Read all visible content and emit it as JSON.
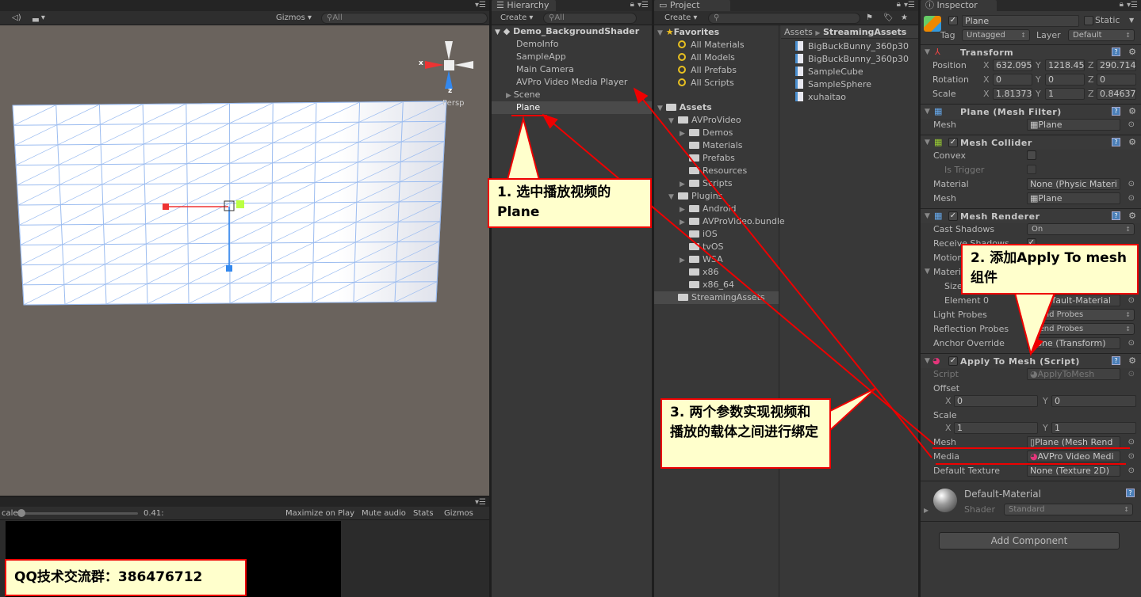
{
  "scene": {
    "gizmos_label": "Gizmos",
    "search_placeholder": "All",
    "gizmo_x": "x",
    "gizmo_z": "z",
    "persp_label": "Persp"
  },
  "game": {
    "scale_label": "cale",
    "scale_value": "0.41:",
    "buttons": [
      "Maximize on Play",
      "Mute audio",
      "Stats",
      "Gizmos"
    ]
  },
  "hierarchy": {
    "tab": "Hierarchy",
    "create": "Create",
    "search_placeholder": "All",
    "scene_name": "Demo_BackgroundShader",
    "items": [
      "DemoInfo",
      "SampleApp",
      "Main Camera",
      "AVPro Video Media Player",
      "Scene",
      "Plane"
    ],
    "selected": "Plane"
  },
  "project": {
    "tab": "Project",
    "create": "Create",
    "favorites_label": "Favorites",
    "favorites": [
      "All Materials",
      "All Models",
      "All Prefabs",
      "All Scripts"
    ],
    "assets_label": "Assets",
    "tree": [
      {
        "name": "AVProVideo",
        "level": 1,
        "arrow": "down"
      },
      {
        "name": "Demos",
        "level": 2,
        "arrow": "right"
      },
      {
        "name": "Materials",
        "level": 2,
        "arrow": ""
      },
      {
        "name": "Prefabs",
        "level": 2,
        "arrow": ""
      },
      {
        "name": "Resources",
        "level": 2,
        "arrow": ""
      },
      {
        "name": "Scripts",
        "level": 2,
        "arrow": "right"
      },
      {
        "name": "Plugins",
        "level": 1,
        "arrow": "down"
      },
      {
        "name": "Android",
        "level": 2,
        "arrow": "right"
      },
      {
        "name": "AVProVideo.bundle",
        "level": 2,
        "arrow": "right"
      },
      {
        "name": "iOS",
        "level": 2,
        "arrow": ""
      },
      {
        "name": "tvOS",
        "level": 2,
        "arrow": ""
      },
      {
        "name": "WSA",
        "level": 2,
        "arrow": "right"
      },
      {
        "name": "x86",
        "level": 2,
        "arrow": ""
      },
      {
        "name": "x86_64",
        "level": 2,
        "arrow": ""
      },
      {
        "name": "StreamingAssets",
        "level": 1,
        "arrow": ""
      }
    ],
    "breadcrumb": [
      "Assets",
      "StreamingAssets"
    ],
    "files": [
      "BigBuckBunny_360p30",
      "BigBuckBunny_360p30",
      "SampleCube",
      "SampleSphere",
      "xuhaitao"
    ]
  },
  "inspector": {
    "tab": "Inspector",
    "object_name": "Plane",
    "static_label": "Static",
    "tag_label": "Tag",
    "tag_value": "Untagged",
    "layer_label": "Layer",
    "layer_value": "Default",
    "transform": {
      "title": "Transform",
      "position_label": "Position",
      "position": [
        "632.095",
        "1218.45",
        "290.714"
      ],
      "rotation_label": "Rotation",
      "rotation": [
        "0",
        "0",
        "0"
      ],
      "scale_label": "Scale",
      "scale": [
        "1.81373",
        "1",
        "0.84637"
      ]
    },
    "mesh_filter": {
      "title": "Plane (Mesh Filter)",
      "mesh_label": "Mesh",
      "mesh_value": "Plane"
    },
    "mesh_collider": {
      "title": "Mesh Collider",
      "convex_label": "Convex",
      "is_trigger_label": "Is Trigger",
      "material_label": "Material",
      "material_value": "None (Physic Materi",
      "mesh_label": "Mesh",
      "mesh_value": "Plane"
    },
    "mesh_renderer": {
      "title": "Mesh Renderer",
      "cast_shadows_label": "Cast Shadows",
      "cast_shadows_value": "On",
      "receive_shadows_label": "Receive Shadows",
      "motion_label": "Motion",
      "materials_label": "Materi",
      "size_label": "Size",
      "element0_label": "Element 0",
      "element0_value": "Default-Material",
      "light_probes_label": "Light Probes",
      "light_probes_value": "Blend Probes",
      "reflection_probes_label": "Reflection Probes",
      "reflection_probes_value": "Blend Probes",
      "anchor_label": "Anchor Override",
      "anchor_value": "None (Transform)"
    },
    "apply_to_mesh": {
      "title": "Apply To Mesh (Script)",
      "script_label": "Script",
      "script_value": "ApplyToMesh",
      "offset_label": "Offset",
      "offset": [
        "0",
        "0"
      ],
      "scale_label": "Scale",
      "scale": [
        "1",
        "1"
      ],
      "mesh_label": "Mesh",
      "mesh_value": "Plane (Mesh Rend",
      "media_label": "Media",
      "media_value": "AVPro Video Medi",
      "default_texture_label": "Default Texture",
      "default_texture_value": "None (Texture 2D)"
    },
    "material": {
      "name": "Default-Material",
      "shader_label": "Shader",
      "shader_value": "Standard"
    },
    "add_component": "Add Component"
  },
  "annotations": {
    "step1": "1. 选中播放视频的Plane",
    "step2": "2. 添加Apply To mesh组件",
    "step3": "3. 两个参数实现视频和播放的载体之间进行绑定",
    "qq": "QQ技术交流群：386476712"
  },
  "colors": {
    "annotation_red": "#ee0000",
    "callout_bg": "#ffffcc",
    "selection": "#4a4a4a"
  }
}
